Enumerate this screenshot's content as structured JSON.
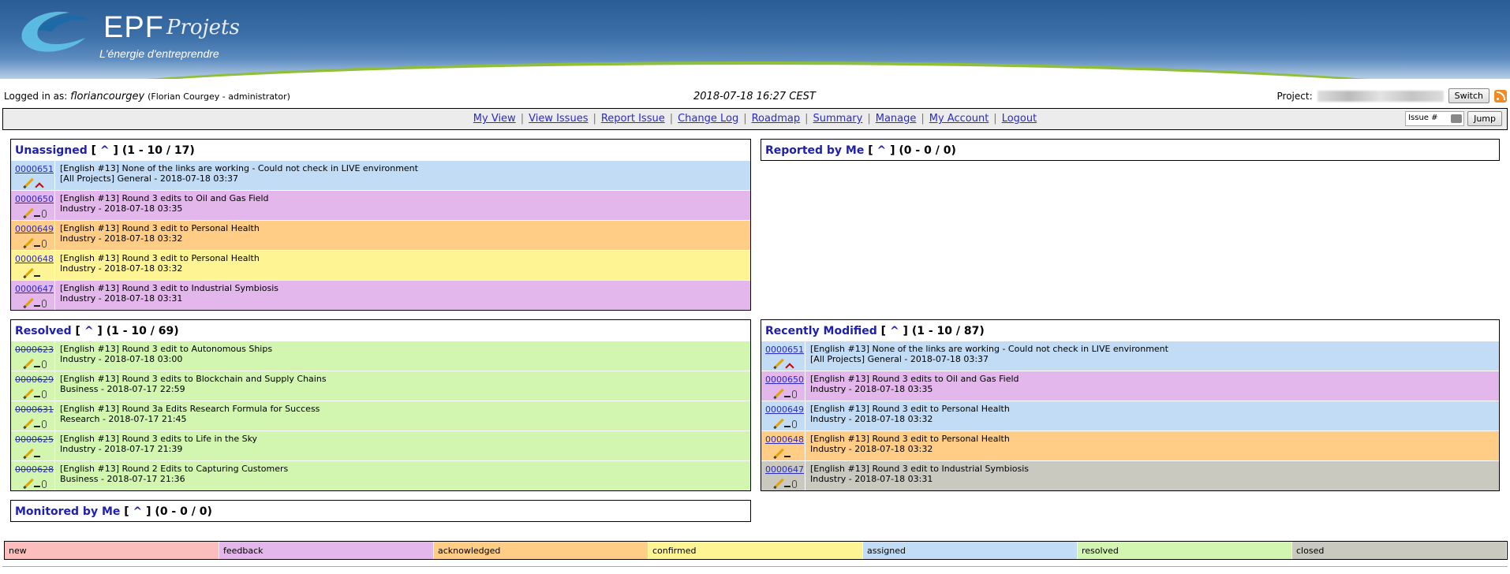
{
  "header": {
    "logo_text": "EPF",
    "logo_script": "Projets",
    "tagline": "L'énergie d'entreprendre"
  },
  "login": {
    "prefix": "Logged in as: ",
    "username": "floriancourgey",
    "details": "(Florian Courgey - administrator)",
    "datetime": "2018-07-18 16:27 CEST",
    "project_label": "Project:",
    "switch_label": "Switch"
  },
  "menu": {
    "items": [
      "My View",
      "View Issues",
      "Report Issue",
      "Change Log",
      "Roadmap",
      "Summary",
      "Manage",
      "My Account",
      "Logout"
    ],
    "jump_placeholder": "Issue #",
    "jump_label": "Jump"
  },
  "boxes": {
    "unassigned": {
      "title": "Unassigned",
      "caret": "^",
      "count": "(1 - 10 / 17)",
      "rows": [
        {
          "id": "0000651",
          "line1": "[English #13] None of the links are working - Could not check in LIVE environment",
          "line2": "[All Projects] General - 2018-07-18 03:37",
          "bg": "#c2dcf5",
          "attach": false,
          "priority": true
        },
        {
          "id": "0000650",
          "line1": "[English #13] Round 3 edits to Oil and Gas Field",
          "line2": "Industry - 2018-07-18 03:35",
          "bg": "#e3b7eb",
          "attach": true,
          "priority": false
        },
        {
          "id": "0000649",
          "line1": "[English #13] Round 3 edit to Personal Health",
          "line2": "Industry - 2018-07-18 03:32",
          "bg": "#ffcd85",
          "attach": true,
          "priority": false
        },
        {
          "id": "0000648",
          "line1": "[English #13] Round 3 edit to Personal Health",
          "line2": "Industry - 2018-07-18 03:32",
          "bg": "#fff494",
          "attach": false,
          "priority": false
        },
        {
          "id": "0000647",
          "line1": "[English #13] Round 3 edit to Industrial Symbiosis",
          "line2": "Industry - 2018-07-18 03:31",
          "bg": "#e3b7eb",
          "attach": true,
          "priority": false
        }
      ]
    },
    "reported": {
      "title": "Reported by Me",
      "caret": "^",
      "count": "(0 - 0 / 0)"
    },
    "resolved": {
      "title": "Resolved",
      "caret": "^",
      "count": "(1 - 10 / 69)",
      "rows": [
        {
          "id": "0000623",
          "line1": "[English #13] Round 3 edit to Autonomous Ships",
          "line2": "Industry - 2018-07-18 03:00",
          "bg": "#d2f5b0",
          "attach": true,
          "priority": false
        },
        {
          "id": "0000629",
          "line1": "[English #13] Round 3 edits to Blockchain and Supply Chains",
          "line2": "Business - 2018-07-17 22:59",
          "bg": "#d2f5b0",
          "attach": true,
          "priority": false
        },
        {
          "id": "0000631",
          "line1": "[English #13] Round 3a Edits Research Formula for Success",
          "line2": "Research - 2018-07-17 21:45",
          "bg": "#d2f5b0",
          "attach": true,
          "priority": false
        },
        {
          "id": "0000625",
          "line1": "[English #13] Round 3 edits to Life in the Sky",
          "line2": "Industry - 2018-07-17 21:39",
          "bg": "#d2f5b0",
          "attach": false,
          "priority": false
        },
        {
          "id": "0000628",
          "line1": "[English #13] Round 2 Edits to Capturing Customers",
          "line2": "Business - 2018-07-17 21:36",
          "bg": "#d2f5b0",
          "attach": true,
          "priority": false
        }
      ]
    },
    "recent": {
      "title": "Recently Modified",
      "caret": "^",
      "count": "(1 - 10 / 87)",
      "rows": [
        {
          "id": "0000651",
          "line1": "[English #13] None of the links are working - Could not check in LIVE environment",
          "line2": "[All Projects] General - 2018-07-18 03:37",
          "bg": "#c2dcf5",
          "attach": false,
          "priority": true
        },
        {
          "id": "0000650",
          "line1": "[English #13] Round 3 edits to Oil and Gas Field",
          "line2": "Industry - 2018-07-18 03:35",
          "bg": "#e3b7eb",
          "attach": true,
          "priority": false
        },
        {
          "id": "0000649",
          "line1": "[English #13] Round 3 edit to Personal Health",
          "line2": "Industry - 2018-07-18 03:32",
          "bg": "#c2dcf5",
          "attach": true,
          "priority": false
        },
        {
          "id": "0000648",
          "line1": "[English #13] Round 3 edit to Personal Health",
          "line2": "Industry - 2018-07-18 03:32",
          "bg": "#ffcd85",
          "attach": false,
          "priority": false
        },
        {
          "id": "0000647",
          "line1": "[English #13] Round 3 edit to Industrial Symbiosis",
          "line2": "Industry - 2018-07-18 03:31",
          "bg": "#c9c9c0",
          "attach": true,
          "priority": false
        }
      ]
    },
    "monitored": {
      "title": "Monitored by Me",
      "caret": "^",
      "count": "(0 - 0 / 0)"
    }
  },
  "legend": [
    {
      "label": "new",
      "color": "#fcbdbd"
    },
    {
      "label": "feedback",
      "color": "#e3b7eb"
    },
    {
      "label": "acknowledged",
      "color": "#ffcd85"
    },
    {
      "label": "confirmed",
      "color": "#fff494"
    },
    {
      "label": "assigned",
      "color": "#c2dcf5"
    },
    {
      "label": "resolved",
      "color": "#d2f5b0"
    },
    {
      "label": "closed",
      "color": "#c9c9c0"
    }
  ]
}
